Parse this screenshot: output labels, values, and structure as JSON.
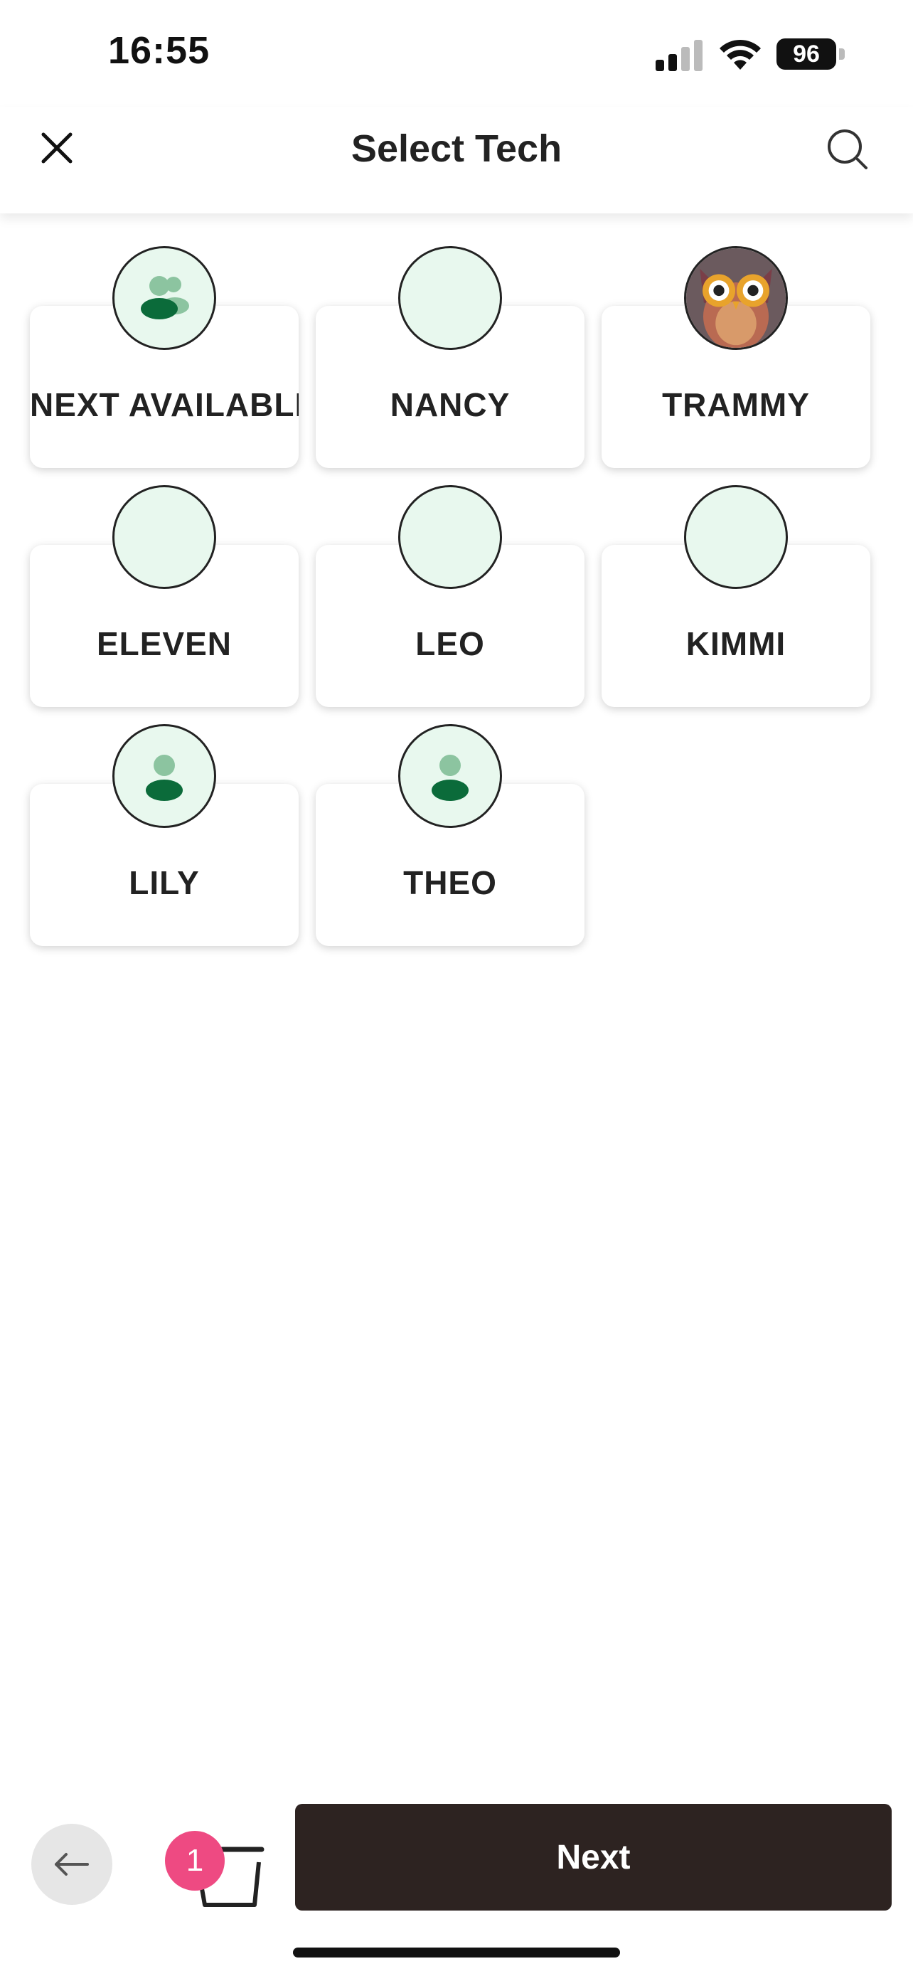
{
  "status_bar": {
    "time": "16:55",
    "battery": "96"
  },
  "header": {
    "title": "Select Tech"
  },
  "techs": [
    {
      "name": "NEXT AVAILABLE",
      "avatar": "group-icon"
    },
    {
      "name": "NANCY",
      "avatar": "blank"
    },
    {
      "name": "TRAMMY",
      "avatar": "owl-photo"
    },
    {
      "name": "ELEVEN",
      "avatar": "blank"
    },
    {
      "name": "LEO",
      "avatar": "blank"
    },
    {
      "name": "KIMMI",
      "avatar": "blank"
    },
    {
      "name": "LILY",
      "avatar": "person-icon"
    },
    {
      "name": "THEO",
      "avatar": "person-icon"
    }
  ],
  "bottom_bar": {
    "cart_count": "1",
    "next_label": "Next"
  },
  "colors": {
    "avatar_bg": "#e8f8ee",
    "icon_dark": "#0b6b3a",
    "icon_light": "#8cc4a0",
    "badge": "#ee4a82",
    "next_bg": "#2d2321"
  }
}
